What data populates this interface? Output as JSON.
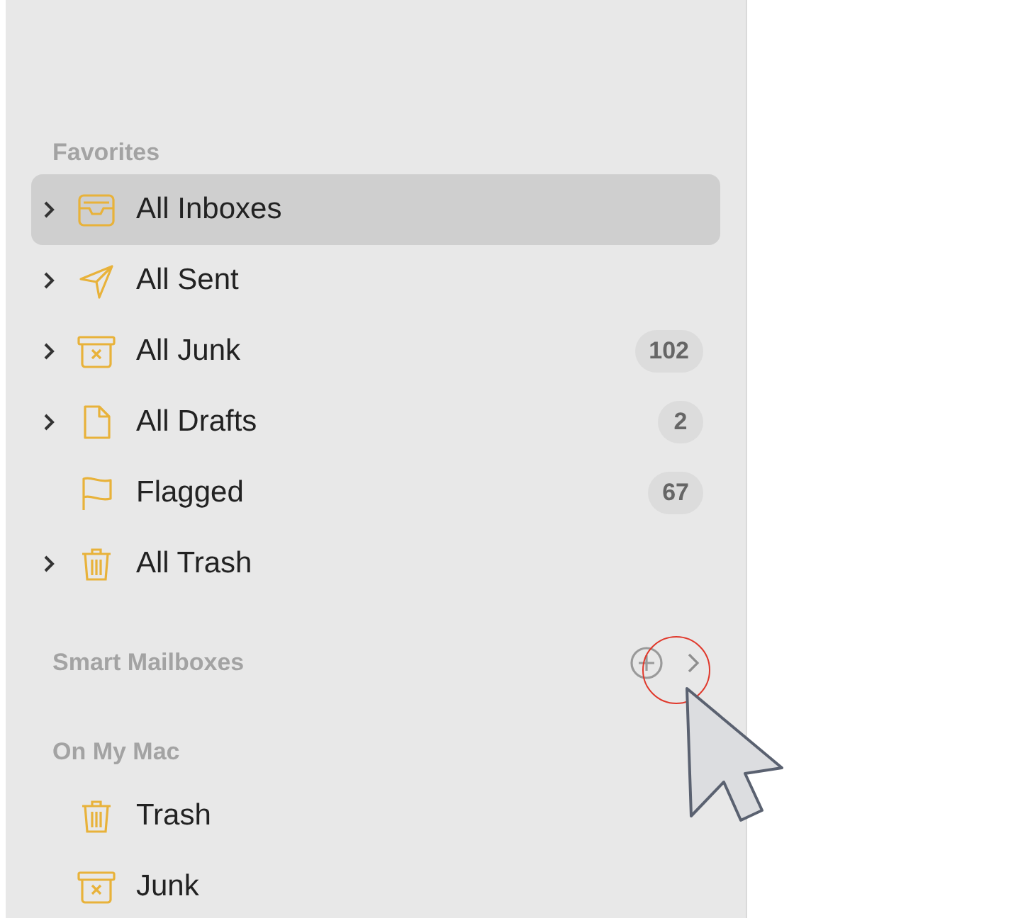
{
  "sidebar": {
    "favorites": {
      "title": "Favorites",
      "items": [
        {
          "kind": "inbox",
          "label": "All Inboxes",
          "expandable": true,
          "selected": true
        },
        {
          "kind": "sent",
          "label": "All Sent",
          "expandable": true,
          "selected": false
        },
        {
          "kind": "junk",
          "label": "All Junk",
          "expandable": true,
          "selected": false,
          "badge": "102"
        },
        {
          "kind": "drafts",
          "label": "All Drafts",
          "expandable": true,
          "selected": false,
          "badge": "2"
        },
        {
          "kind": "flag",
          "label": "Flagged",
          "expandable": false,
          "selected": false,
          "badge": "67"
        },
        {
          "kind": "trash",
          "label": "All Trash",
          "expandable": true,
          "selected": false
        }
      ]
    },
    "smart_mailboxes": {
      "title": "Smart Mailboxes",
      "highlighted": true
    },
    "on_my_mac": {
      "title": "On My Mac",
      "items": [
        {
          "kind": "trash",
          "label": "Trash",
          "selected": false
        },
        {
          "kind": "junk",
          "label": "Junk",
          "selected": false
        }
      ]
    }
  }
}
